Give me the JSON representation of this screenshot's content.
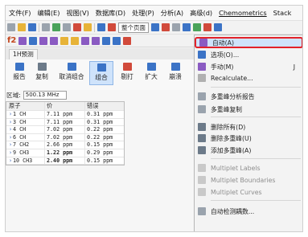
{
  "menubar": {
    "items": [
      "文件(F)",
      "编辑(E)",
      "视图(V)",
      "数据库(D)",
      "处理(P)",
      "分析(A)",
      "高级(d)",
      "Chemometrics",
      "Stack"
    ]
  },
  "toolbar1": {
    "page_combo": "整个页面"
  },
  "toolbar2": {
    "prefix": "f2"
  },
  "panel": {
    "tab": "1H预测",
    "ribbon": [
      "报告",
      "复制",
      "取消组合",
      "组合",
      "剔打",
      "扩大",
      "崩溃"
    ],
    "region_label": "区域:",
    "region_value": "500.13 MHz",
    "table": {
      "headers": [
        "原子",
        "价",
        "错误"
      ],
      "rows": [
        {
          "atom": "1  CH",
          "shift": "7.11 ppm",
          "err": "0.31 ppm",
          "bold": false
        },
        {
          "atom": "3  CH",
          "shift": "7.11 ppm",
          "err": "0.31 ppm",
          "bold": false
        },
        {
          "atom": "4  CH",
          "shift": "7.02 ppm",
          "err": "0.22 ppm",
          "bold": false
        },
        {
          "atom": "6  CH",
          "shift": "7.02 ppm",
          "err": "0.22 ppm",
          "bold": false
        },
        {
          "atom": "7  CH2",
          "shift": "2.66 ppm",
          "err": "0.15 ppm",
          "bold": false
        },
        {
          "atom": "9  CH3",
          "shift": "1.22 ppm",
          "err": "0.29 ppm",
          "bold": true
        },
        {
          "atom": "10  CH3",
          "shift": "2.40 ppm",
          "err": "0.15 ppm",
          "bold": true
        }
      ]
    }
  },
  "dropdown": {
    "items": [
      {
        "label": "自动(A)",
        "key": "",
        "dim": false,
        "highlight": true
      },
      {
        "label": "选项(O)...",
        "key": "",
        "dim": false,
        "highlight": false
      },
      {
        "label": "手动(M)",
        "key": "J",
        "dim": false,
        "highlight": false
      },
      {
        "label": "Recalculate...",
        "key": "",
        "dim": false,
        "highlight": false
      },
      {
        "label": "多重峰分析报告",
        "key": "",
        "dim": false,
        "highlight": false
      },
      {
        "label": "多重峰复制",
        "key": "",
        "dim": false,
        "highlight": false
      },
      {
        "label": "删除所有(D)",
        "key": "",
        "dim": false,
        "highlight": false
      },
      {
        "label": "删除多重峰(U)",
        "key": "",
        "dim": false,
        "highlight": false
      },
      {
        "label": "添加多重峰(A)",
        "key": "",
        "dim": false,
        "highlight": false
      },
      {
        "label": "Multiplet Labels",
        "key": "",
        "dim": true,
        "highlight": false
      },
      {
        "label": "Multiplet Boundaries",
        "key": "",
        "dim": true,
        "highlight": false
      },
      {
        "label": "Multiplet Curves",
        "key": "",
        "dim": true,
        "highlight": false
      },
      {
        "label": "自动检测耦数...",
        "key": "",
        "dim": false,
        "highlight": false
      }
    ]
  }
}
